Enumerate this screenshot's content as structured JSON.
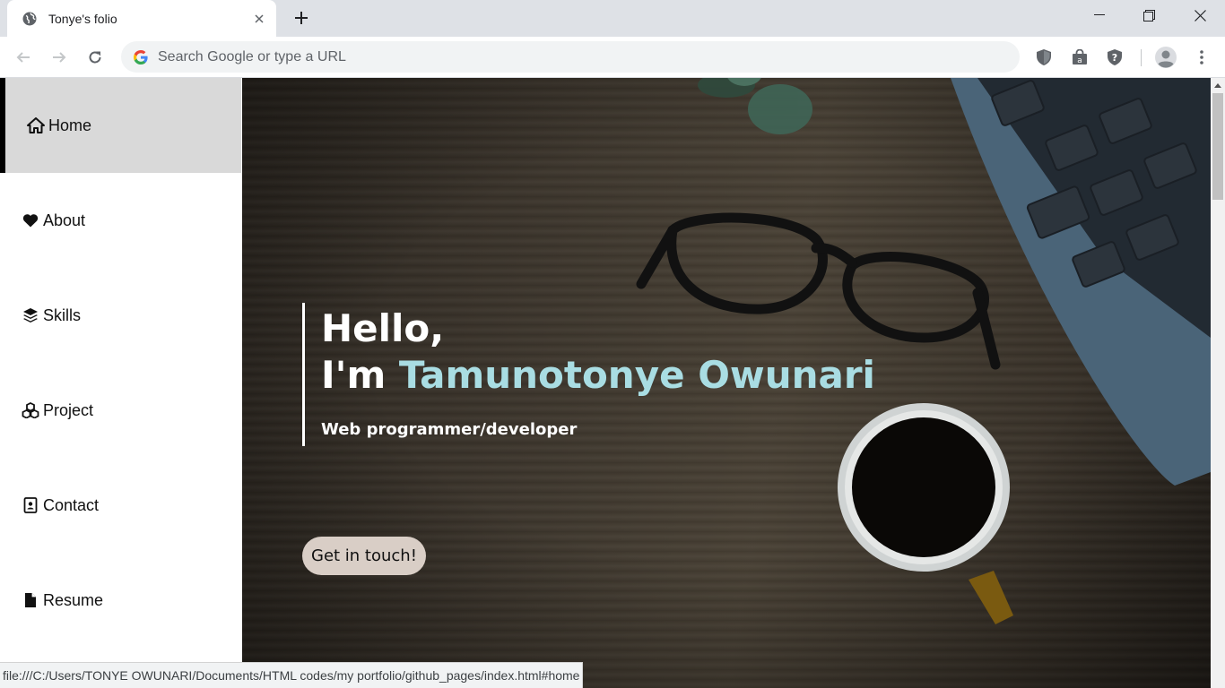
{
  "browser": {
    "tab_title": "Tonye's folio",
    "omnibox_placeholder": "Search Google or type a URL",
    "status_url": "file:///C:/Users/TONYE OWUNARI/Documents/HTML codes/my portfolio/github_pages/index.html#home"
  },
  "sidebar": {
    "items": [
      {
        "label": "Home",
        "icon": "home-icon",
        "active": true
      },
      {
        "label": "About",
        "icon": "heart-icon",
        "active": false
      },
      {
        "label": "Skills",
        "icon": "layers-icon",
        "active": false
      },
      {
        "label": "Project",
        "icon": "cubes-icon",
        "active": false
      },
      {
        "label": "Contact",
        "icon": "address-card-icon",
        "active": false
      },
      {
        "label": "Resume",
        "icon": "file-icon",
        "active": false
      }
    ]
  },
  "hero": {
    "greeting": "Hello,",
    "intro_prefix": "I'm",
    "name": "Tamunotonye Owunari",
    "role": "Web programmer/developer",
    "cta_label": "Get in touch!"
  },
  "colors": {
    "name_accent": "#a9dde3",
    "active_nav_bg": "#d9d9d9",
    "cta_bg": "#d9cec6"
  }
}
